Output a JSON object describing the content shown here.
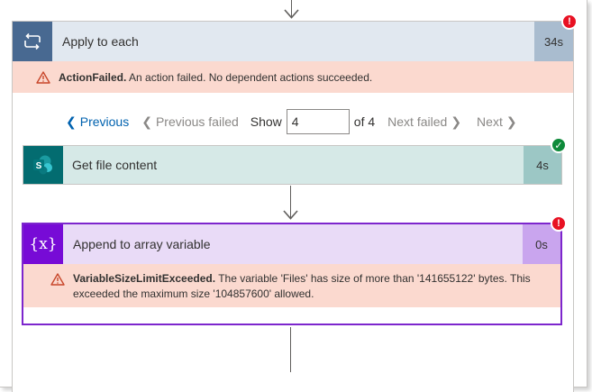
{
  "loop": {
    "title": "Apply to each",
    "duration": "34s",
    "status_badge": "!",
    "error": {
      "code": "ActionFailed.",
      "message": " An action failed. No dependent actions succeeded."
    }
  },
  "pager": {
    "previous": "Previous",
    "previous_failed": "Previous failed",
    "show_label": "Show",
    "current_value": "4",
    "of_label": "of 4",
    "next_failed": "Next failed",
    "next": "Next"
  },
  "get_file": {
    "title": "Get file content",
    "duration": "4s",
    "icon_letter": "S",
    "status_badge": "✓"
  },
  "append": {
    "title": "Append to array variable",
    "duration": "0s",
    "icon_text": "{x}",
    "status_badge": "!",
    "error": {
      "code": "VariableSizeLimitExceeded.",
      "message": " The variable 'Files' has size of more than '141655122' bytes. This exceeded the maximum size '104857600' allowed."
    }
  },
  "colors": {
    "loop_accent": "#486991",
    "sharepoint_accent": "#036c70",
    "variable_accent": "#770bd6",
    "error_bg": "#fbd9cf",
    "link": "#0062af"
  }
}
